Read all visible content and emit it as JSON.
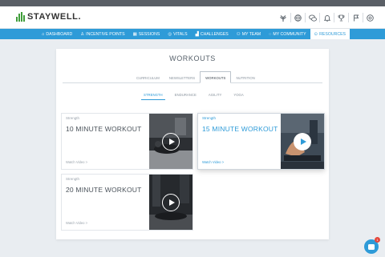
{
  "app": {
    "logo_text": "STAYWELL."
  },
  "header_icons": [
    "lifestyle-icon",
    "globe-icon",
    "chat-icon",
    "bell-icon",
    "trophy-icon",
    "flag-icon",
    "help-icon"
  ],
  "nav": {
    "items": [
      {
        "label": "DASHBOARD",
        "icon": "home-icon"
      },
      {
        "label": "INCENTIVE POINTS",
        "icon": "trophy-icon"
      },
      {
        "label": "SESSIONS",
        "icon": "calendar-icon"
      },
      {
        "label": "VITALS",
        "icon": "vitals-icon"
      },
      {
        "label": "CHALLENGES",
        "icon": "chart-icon"
      },
      {
        "label": "MY TEAM",
        "icon": "team-icon"
      },
      {
        "label": "MY COMMUNITY",
        "icon": "community-icon"
      },
      {
        "label": "RESOURCES",
        "icon": "resources-icon",
        "active": true
      }
    ]
  },
  "page": {
    "title": "WORKOUTS"
  },
  "tabs": [
    {
      "label": "CURRICULUM"
    },
    {
      "label": "NEWSLETTERS"
    },
    {
      "label": "WORKOUTS",
      "active": true
    },
    {
      "label": "NUTRITION"
    }
  ],
  "subtabs": [
    {
      "label": "STRENGTH",
      "active": true
    },
    {
      "label": "ENDURANCE"
    },
    {
      "label": "AGILITY"
    },
    {
      "label": "YOGA"
    }
  ],
  "workouts": [
    {
      "category": "Strength",
      "title": "10 MINUTE WORKOUT",
      "watch": "Watch Video >",
      "highlighted": false
    },
    {
      "category": "Strength",
      "title": "15 MINUTE WORKOUT",
      "watch": "Watch Video >",
      "highlighted": true
    },
    {
      "category": "Strength",
      "title": "20 MINUTE WORKOUT",
      "watch": "Watch Video >",
      "highlighted": false
    }
  ],
  "chat": {
    "badge": "1"
  },
  "colors": {
    "accent": "#2e9bd8",
    "nav_bg": "#2e9bd8",
    "logo_green": "#3f9d3a",
    "badge": "#e5483d"
  }
}
